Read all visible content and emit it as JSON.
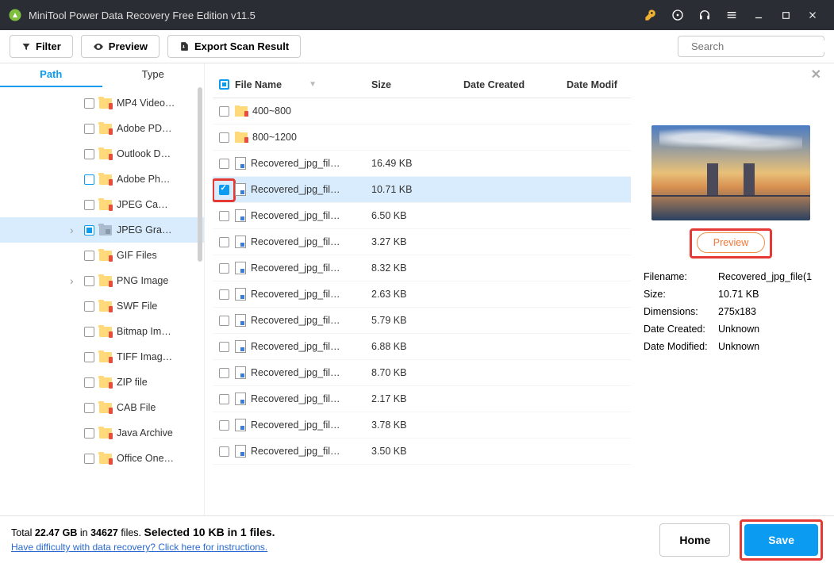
{
  "window": {
    "title": "MiniTool Power Data Recovery Free Edition v11.5"
  },
  "toolbar": {
    "filter": "Filter",
    "preview": "Preview",
    "export": "Export Scan Result",
    "search_placeholder": "Search"
  },
  "tabs": {
    "path": "Path",
    "type": "Type"
  },
  "tree": [
    {
      "label": "MP4 Video…",
      "selected": false,
      "expandable": false
    },
    {
      "label": "Adobe PD…",
      "selected": false,
      "expandable": false
    },
    {
      "label": "Outlook D…",
      "selected": false,
      "expandable": false
    },
    {
      "label": "Adobe Ph…",
      "selected": false,
      "expandable": false,
      "chkblue": true
    },
    {
      "label": "JPEG Ca…",
      "selected": false,
      "expandable": false
    },
    {
      "label": "JPEG Gra…",
      "selected": true,
      "expandable": true,
      "gray": true
    },
    {
      "label": "GIF Files",
      "selected": false,
      "expandable": false
    },
    {
      "label": "PNG Image",
      "selected": false,
      "expandable": true
    },
    {
      "label": "SWF File",
      "selected": false,
      "expandable": false
    },
    {
      "label": "Bitmap Im…",
      "selected": false,
      "expandable": false
    },
    {
      "label": "TIFF Imag…",
      "selected": false,
      "expandable": false
    },
    {
      "label": "ZIP file",
      "selected": false,
      "expandable": false
    },
    {
      "label": "CAB File",
      "selected": false,
      "expandable": false
    },
    {
      "label": "Java Archive",
      "selected": false,
      "expandable": false
    },
    {
      "label": "Office One…",
      "selected": false,
      "expandable": false
    }
  ],
  "columns": {
    "name": "File Name",
    "size": "Size",
    "created": "Date Created",
    "modified": "Date Modif"
  },
  "files": [
    {
      "name": "400~800",
      "size": "",
      "folder": true
    },
    {
      "name": "800~1200",
      "size": "",
      "folder": true
    },
    {
      "name": "Recovered_jpg_fil…",
      "size": "16.49 KB"
    },
    {
      "name": "Recovered_jpg_fil…",
      "size": "10.71 KB",
      "checked": true,
      "selected": true,
      "highlight": true
    },
    {
      "name": "Recovered_jpg_fil…",
      "size": "6.50 KB"
    },
    {
      "name": "Recovered_jpg_fil…",
      "size": "3.27 KB"
    },
    {
      "name": "Recovered_jpg_fil…",
      "size": "8.32 KB"
    },
    {
      "name": "Recovered_jpg_fil…",
      "size": "2.63 KB"
    },
    {
      "name": "Recovered_jpg_fil…",
      "size": "5.79 KB"
    },
    {
      "name": "Recovered_jpg_fil…",
      "size": "6.88 KB"
    },
    {
      "name": "Recovered_jpg_fil…",
      "size": "8.70 KB"
    },
    {
      "name": "Recovered_jpg_fil…",
      "size": "2.17 KB"
    },
    {
      "name": "Recovered_jpg_fil…",
      "size": "3.78 KB"
    },
    {
      "name": "Recovered_jpg_fil…",
      "size": "3.50 KB"
    }
  ],
  "preview": {
    "button": "Preview",
    "meta": {
      "filename_lbl": "Filename:",
      "filename": "Recovered_jpg_file(1",
      "size_lbl": "Size:",
      "size": "10.71 KB",
      "dim_lbl": "Dimensions:",
      "dim": "275x183",
      "created_lbl": "Date Created:",
      "created": "Unknown",
      "modified_lbl": "Date Modified:",
      "modified": "Unknown"
    }
  },
  "footer": {
    "total_prefix": "Total ",
    "total_gb": "22.47 GB",
    "total_in": " in ",
    "total_files": "34627",
    "total_suffix": " files. ",
    "selected_prefix": "Selected ",
    "selected_kb": "10 KB",
    "selected_in": " in ",
    "selected_count": "1",
    "selected_suffix": " files.",
    "link": "Have difficulty with data recovery? Click here for instructions.",
    "home": "Home",
    "save": "Save"
  }
}
